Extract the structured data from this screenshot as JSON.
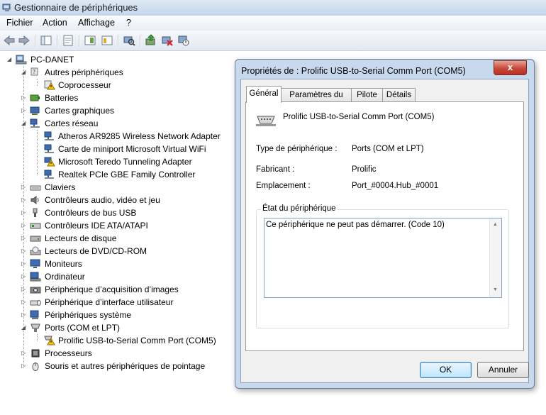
{
  "window": {
    "title": "Gestionnaire de périphériques"
  },
  "menu": [
    "Fichier",
    "Action",
    "Affichage",
    "?"
  ],
  "tree": {
    "root": "PC-DANET",
    "items": [
      {
        "label": "Autres périphériques",
        "level": 1,
        "expanded": true
      },
      {
        "label": "Coprocesseur",
        "level": 2,
        "warning": true
      },
      {
        "label": "Batteries",
        "level": 1
      },
      {
        "label": "Cartes graphiques",
        "level": 1
      },
      {
        "label": "Cartes réseau",
        "level": 1,
        "expanded": true
      },
      {
        "label": "Atheros AR9285 Wireless Network Adapter",
        "level": 2
      },
      {
        "label": "Carte de miniport Microsoft Virtual WiFi",
        "level": 2
      },
      {
        "label": "Microsoft Teredo Tunneling Adapter",
        "level": 2,
        "warning": true
      },
      {
        "label": "Realtek PCIe GBE Family Controller",
        "level": 2
      },
      {
        "label": "Claviers",
        "level": 1
      },
      {
        "label": "Contrôleurs audio, vidéo et jeu",
        "level": 1
      },
      {
        "label": "Contrôleurs de bus USB",
        "level": 1
      },
      {
        "label": "Contrôleurs IDE ATA/ATAPI",
        "level": 1
      },
      {
        "label": "Lecteurs de disque",
        "level": 1
      },
      {
        "label": "Lecteurs de DVD/CD-ROM",
        "level": 1
      },
      {
        "label": "Moniteurs",
        "level": 1
      },
      {
        "label": "Ordinateur",
        "level": 1
      },
      {
        "label": "Périphérique d’acquisition d’images",
        "level": 1
      },
      {
        "label": "Périphérique d’interface utilisateur",
        "level": 1
      },
      {
        "label": "Périphériques système",
        "level": 1
      },
      {
        "label": "Ports (COM et LPT)",
        "level": 1,
        "expanded": true
      },
      {
        "label": "Prolific USB-to-Serial Comm Port (COM5)",
        "level": 2,
        "warning": true
      },
      {
        "label": "Processeurs",
        "level": 1
      },
      {
        "label": "Souris et autres périphériques de pointage",
        "level": 1
      }
    ]
  },
  "dialog": {
    "title": "Propriétés de : Prolific USB-to-Serial Comm Port (COM5)",
    "close_glyph": "x",
    "tabs": [
      "Général",
      "Paramètres du port",
      "Pilote",
      "Détails"
    ],
    "active_tab": "Général",
    "device_name": "Prolific USB-to-Serial Comm Port (COM5)",
    "props": [
      {
        "label": "Type de périphérique :",
        "value": "Ports (COM et LPT)"
      },
      {
        "label": "Fabricant :",
        "value": "Prolific"
      },
      {
        "label": "Emplacement :",
        "value": "Port_#0004.Hub_#0001"
      }
    ],
    "status_label": "État du périphérique",
    "status_text": "Ce périphérique ne peut pas démarrer. (Code 10)",
    "ok_label": "OK",
    "cancel_label": "Annuler"
  }
}
